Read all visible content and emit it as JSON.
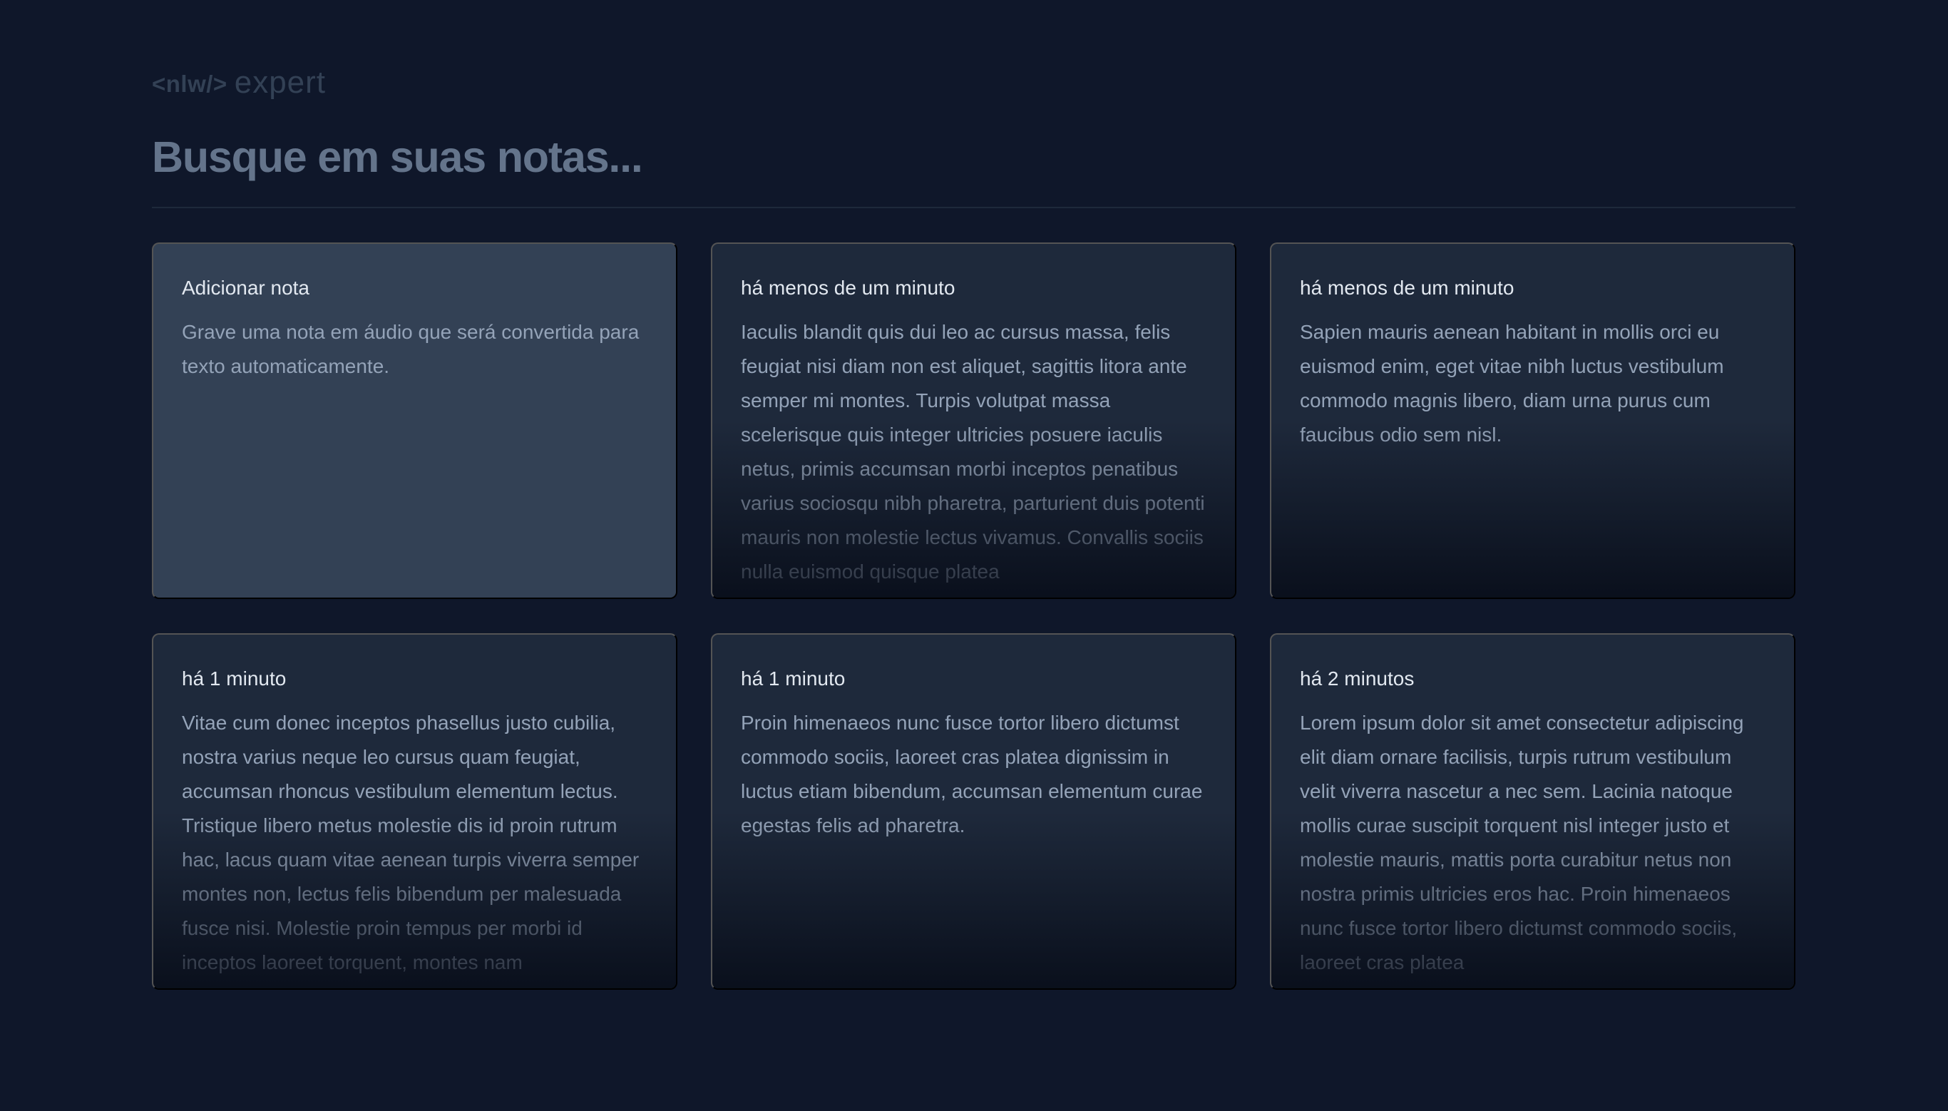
{
  "logo": {
    "code_text": "<nlw/>",
    "word_text": "expert"
  },
  "search": {
    "placeholder": "Busque em suas notas..."
  },
  "add_card": {
    "title": "Adicionar nota",
    "description": "Grave uma nota em áudio que será convertida para texto automaticamente."
  },
  "notes": [
    {
      "date": "há menos de um minuto",
      "content": "Iaculis blandit quis dui leo ac cursus massa, felis feugiat nisi diam non est aliquet, sagittis litora ante semper mi montes. Turpis volutpat massa scelerisque quis integer ultricies posuere iaculis netus, primis accumsan morbi inceptos penatibus varius sociosqu nibh pharetra, parturient duis potenti mauris non molestie lectus vivamus. Convallis sociis nulla euismod quisque platea"
    },
    {
      "date": "há menos de um minuto",
      "content": "Sapien mauris aenean habitant in mollis orci eu euismod enim, eget vitae nibh luctus vestibulum commodo magnis libero, diam urna purus cum faucibus odio sem nisl."
    },
    {
      "date": "há 1 minuto",
      "content": "Vitae cum donec inceptos phasellus justo cubilia, nostra varius neque leo cursus quam feugiat, accumsan rhoncus vestibulum elementum lectus. Tristique libero metus molestie dis id proin rutrum hac, lacus quam vitae aenean turpis viverra semper montes non, lectus felis bibendum per malesuada fusce nisi. Molestie proin tempus per morbi id inceptos laoreet torquent, montes nam"
    },
    {
      "date": "há 1 minuto",
      "content": "Proin himenaeos nunc fusce tortor libero dictumst commodo sociis, laoreet cras platea dignissim in luctus etiam bibendum, accumsan elementum curae egestas felis ad pharetra."
    },
    {
      "date": "há 2 minutos",
      "content": "Lorem ipsum dolor sit amet consectetur adipiscing elit diam ornare facilisis, turpis rutrum vestibulum velit viverra nascetur a nec sem. Lacinia natoque mollis curae suscipit torquent nisl integer justo et molestie mauris, mattis porta curabitur netus non nostra primis ultricies eros hac. Proin himenaeos nunc fusce tortor libero dictumst commodo sociis, laoreet cras platea"
    }
  ],
  "colors": {
    "background": "#0f172a",
    "card": "#1e293b",
    "add_card": "#334155",
    "title_text": "#e2e8f0",
    "body_text": "#94a3b8",
    "placeholder": "#64748b"
  }
}
